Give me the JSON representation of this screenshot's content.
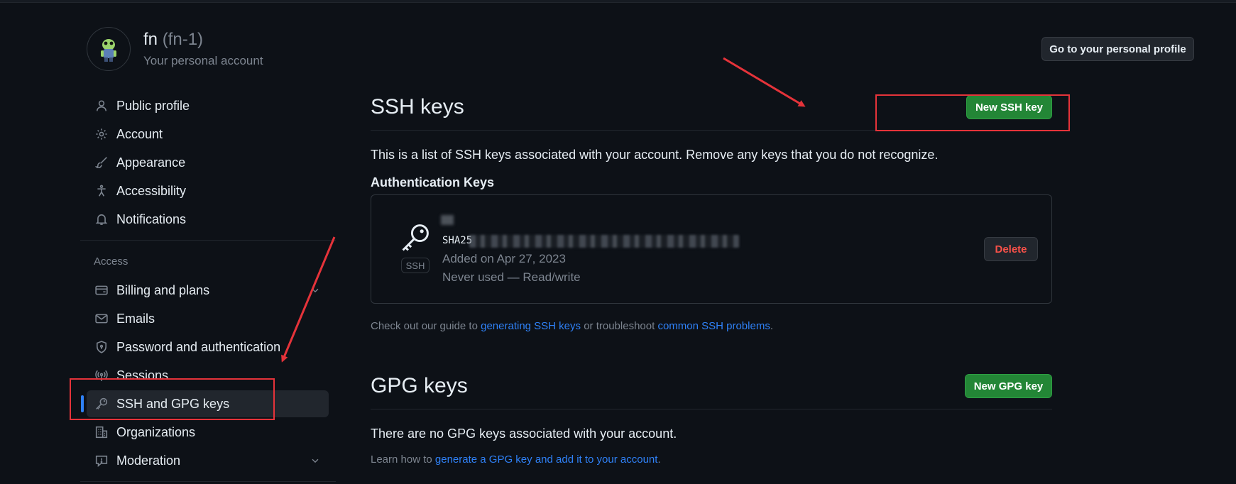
{
  "account": {
    "name": "fn",
    "login": "(fn-1)",
    "subtitle": "Your personal account",
    "profile_button": "Go to your personal profile"
  },
  "sidebar": {
    "items": [
      {
        "label": "Public profile",
        "icon": "person-icon"
      },
      {
        "label": "Account",
        "icon": "gear-icon"
      },
      {
        "label": "Appearance",
        "icon": "paintbrush-icon"
      },
      {
        "label": "Accessibility",
        "icon": "accessibility-icon"
      },
      {
        "label": "Notifications",
        "icon": "bell-icon"
      }
    ],
    "access_heading": "Access",
    "access_items": [
      {
        "label": "Billing and plans",
        "icon": "credit-card-icon"
      },
      {
        "label": "Emails",
        "icon": "mail-icon"
      },
      {
        "label": "Password and authentication",
        "icon": "shield-lock-icon"
      },
      {
        "label": "Sessions",
        "icon": "broadcast-icon"
      },
      {
        "label": "SSH and GPG keys",
        "icon": "key-icon",
        "active": true
      },
      {
        "label": "Organizations",
        "icon": "organization-icon"
      },
      {
        "label": "Moderation",
        "icon": "report-icon"
      }
    ]
  },
  "ssh": {
    "title": "SSH keys",
    "new_button": "New SSH key",
    "description": "This is a list of SSH keys associated with your account. Remove any keys that you do not recognize.",
    "auth_heading": "Authentication Keys",
    "key": {
      "badge": "SSH",
      "fingerprint_prefix": "SHA25",
      "added": "Added on Apr 27, 2023",
      "usage": "Never used — Read/write",
      "delete_button": "Delete"
    },
    "guide": {
      "pre": "Check out our guide to ",
      "link1": "generating SSH keys",
      "mid": " or troubleshoot ",
      "link2": "common SSH problems",
      "post": "."
    }
  },
  "gpg": {
    "title": "GPG keys",
    "new_button": "New GPG key",
    "empty": "There are no GPG keys associated with your account.",
    "learn": {
      "pre": "Learn how to ",
      "link": "generate a GPG key and add it to your account",
      "post": "."
    }
  },
  "colors": {
    "background": "#0d1117",
    "accent_blue": "#2f81f7",
    "green_button": "#238636",
    "danger": "#f85149",
    "annotation_red": "#e5333a"
  }
}
